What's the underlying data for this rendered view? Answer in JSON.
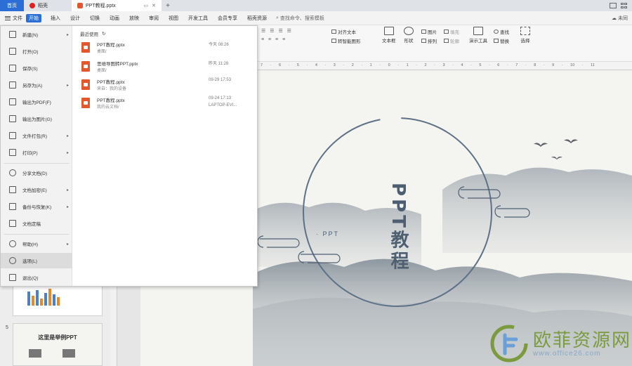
{
  "titlebar": {
    "home_tab": "首页",
    "draw_tab": "稻壳",
    "doc_tab": "PPT教程.pptx",
    "new_tab_symbol": "+"
  },
  "menubar": {
    "file_label": "文件",
    "start_label": "开始",
    "items": [
      "插入",
      "设计",
      "切换",
      "动画",
      "放映",
      "审阅",
      "视图",
      "开发工具",
      "会员专享",
      "稻壳资源"
    ],
    "search_placeholder": "查找命令、搜索模板",
    "cloud_label": "未同"
  },
  "ribbon": {
    "align_text": "对齐文本",
    "convert_smartart": "转智能图形",
    "textbox": "文本框",
    "shape": "形状",
    "picture": "图片",
    "arrange": "排列",
    "fill": "填充",
    "outline": "轮廓",
    "presenter_tools": "演示工具",
    "find": "查找",
    "replace": "替换",
    "select": "选择"
  },
  "ruler": {
    "marks": "7 · 6 · 5 · 4 · 3 · 2 · 1 · 0 · 1 · 2 · 3 · 4 · 5 · 6 · 7 · 8 · 9 · 10 · 11"
  },
  "file_menu": {
    "items": [
      {
        "label": "新建(N)",
        "icon": "new-doc-icon",
        "arrow": true
      },
      {
        "label": "打开(O)",
        "icon": "folder-open-icon",
        "arrow": false
      },
      {
        "label": "保存(S)",
        "icon": "save-icon",
        "arrow": false
      },
      {
        "label": "另存为(A)",
        "icon": "save-as-icon",
        "arrow": true
      },
      {
        "label": "输出为PDF(F)",
        "icon": "pdf-icon",
        "arrow": false
      },
      {
        "label": "输出为图片(G)",
        "icon": "image-export-icon",
        "arrow": false
      },
      {
        "label": "文件打包(R)",
        "icon": "package-icon",
        "arrow": true
      },
      {
        "label": "打印(P)",
        "icon": "print-icon",
        "arrow": true
      },
      {
        "label": "分享文档(D)",
        "icon": "share-icon",
        "arrow": false
      },
      {
        "label": "文档加密(E)",
        "icon": "lock-icon",
        "arrow": true
      },
      {
        "label": "备份与恢复(K)",
        "icon": "backup-icon",
        "arrow": true
      },
      {
        "label": "文档定稿",
        "icon": "finalize-icon",
        "arrow": false
      },
      {
        "label": "帮助(H)",
        "icon": "help-icon",
        "arrow": true
      },
      {
        "label": "选项(L)",
        "icon": "gear-icon",
        "arrow": false
      },
      {
        "label": "退出(Q)",
        "icon": "exit-icon",
        "arrow": false
      }
    ],
    "recent_title": "最近使用",
    "recent_files": [
      {
        "name": "PPT教程.pptx",
        "path": "桌面/",
        "time": "今天  08:26",
        "location": ""
      },
      {
        "name": "思维导图转PPT.pptx",
        "path": "桌面/",
        "time": "昨天  11:28",
        "location": ""
      },
      {
        "name": "PPT教程.pptx",
        "path": "来自：我的设备",
        "time": "09-29  17:53",
        "location": ""
      },
      {
        "name": "PPT教程.pptx",
        "path": "我的云文档/",
        "time": "09-24  17:13",
        "location": "LAPTOP-EVI..."
      }
    ]
  },
  "thumbnails": {
    "slide5_number": "5",
    "slide5_title": "这里是举例PPT"
  },
  "slide": {
    "title": "PPT教程",
    "subtitle": "· PPT"
  },
  "watermark": {
    "text": "欧菲资源网",
    "url": "www.office26.com"
  },
  "colors": {
    "accent": "#2b6fd6",
    "slide_text": "#4e5f72",
    "ppt_icon": "#e2572b",
    "watermark_green": "#7c9a3e"
  }
}
